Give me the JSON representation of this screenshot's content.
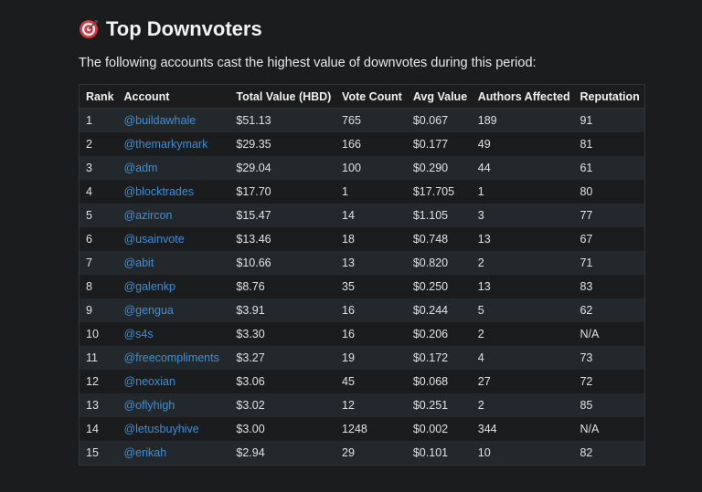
{
  "header": {
    "title": "Top Downvoters",
    "icon": "target-icon",
    "subtitle": "The following accounts cast the highest value of downvotes during this period:"
  },
  "colors": {
    "background": "#1a1c1e",
    "row_alt": "#23282c",
    "link": "#3d8fd9",
    "icon_red": "#e0303a"
  },
  "table": {
    "columns": [
      "Rank",
      "Account",
      "Total Value (HBD)",
      "Vote Count",
      "Avg Value",
      "Authors Affected",
      "Reputation"
    ],
    "rows": [
      {
        "rank": "1",
        "account": "@buildawhale",
        "total": "$51.13",
        "count": "765",
        "avg": "$0.067",
        "authors": "189",
        "rep": "91"
      },
      {
        "rank": "2",
        "account": "@themarkymark",
        "total": "$29.35",
        "count": "166",
        "avg": "$0.177",
        "authors": "49",
        "rep": "81"
      },
      {
        "rank": "3",
        "account": "@adm",
        "total": "$29.04",
        "count": "100",
        "avg": "$0.290",
        "authors": "44",
        "rep": "61"
      },
      {
        "rank": "4",
        "account": "@blocktrades",
        "total": "$17.70",
        "count": "1",
        "avg": "$17.705",
        "authors": "1",
        "rep": "80"
      },
      {
        "rank": "5",
        "account": "@azircon",
        "total": "$15.47",
        "count": "14",
        "avg": "$1.105",
        "authors": "3",
        "rep": "77"
      },
      {
        "rank": "6",
        "account": "@usainvote",
        "total": "$13.46",
        "count": "18",
        "avg": "$0.748",
        "authors": "13",
        "rep": "67"
      },
      {
        "rank": "7",
        "account": "@abit",
        "total": "$10.66",
        "count": "13",
        "avg": "$0.820",
        "authors": "2",
        "rep": "71"
      },
      {
        "rank": "8",
        "account": "@galenkp",
        "total": "$8.76",
        "count": "35",
        "avg": "$0.250",
        "authors": "13",
        "rep": "83"
      },
      {
        "rank": "9",
        "account": "@gengua",
        "total": "$3.91",
        "count": "16",
        "avg": "$0.244",
        "authors": "5",
        "rep": "62"
      },
      {
        "rank": "10",
        "account": "@s4s",
        "total": "$3.30",
        "count": "16",
        "avg": "$0.206",
        "authors": "2",
        "rep": "N/A"
      },
      {
        "rank": "11",
        "account": "@freecompliments",
        "total": "$3.27",
        "count": "19",
        "avg": "$0.172",
        "authors": "4",
        "rep": "73"
      },
      {
        "rank": "12",
        "account": "@neoxian",
        "total": "$3.06",
        "count": "45",
        "avg": "$0.068",
        "authors": "27",
        "rep": "72"
      },
      {
        "rank": "13",
        "account": "@oflyhigh",
        "total": "$3.02",
        "count": "12",
        "avg": "$0.251",
        "authors": "2",
        "rep": "85"
      },
      {
        "rank": "14",
        "account": "@letusbuyhive",
        "total": "$3.00",
        "count": "1248",
        "avg": "$0.002",
        "authors": "344",
        "rep": "N/A"
      },
      {
        "rank": "15",
        "account": "@erikah",
        "total": "$2.94",
        "count": "29",
        "avg": "$0.101",
        "authors": "10",
        "rep": "82"
      }
    ]
  }
}
